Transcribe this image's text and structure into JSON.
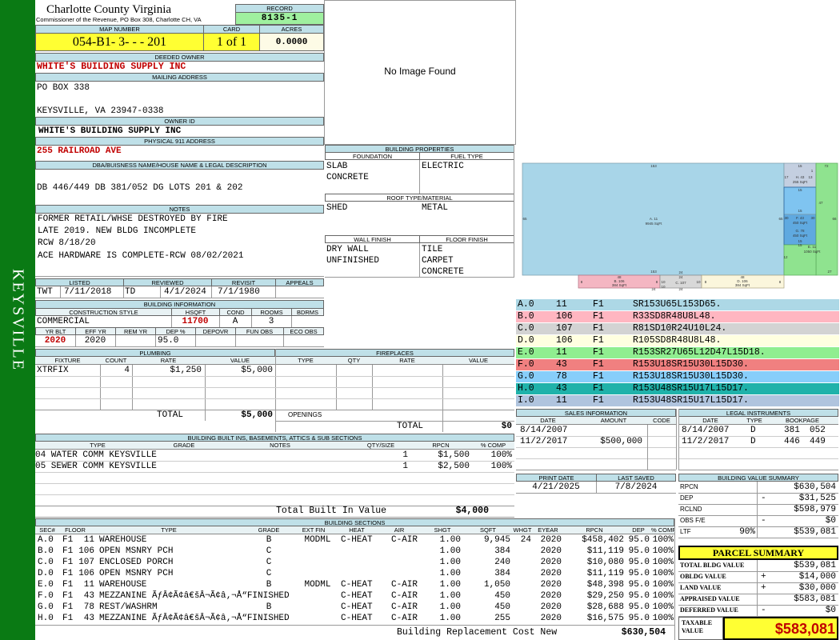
{
  "header": {
    "county": "Charlotte County Virginia",
    "office": "Commissioner of the Revenue, PO Box 308, Charlotte CH, VA",
    "side_label": "KEYSVILLE"
  },
  "record": {
    "label": "RECORD",
    "value": "8135-1"
  },
  "map_number": {
    "label": "MAP NUMBER",
    "value": "054-B1- 3-   -   - 201"
  },
  "card": {
    "label": "CARD",
    "value": "1 of 1"
  },
  "acres": {
    "label": "ACRES",
    "value": "0.0000"
  },
  "deeded_owner": {
    "label": "DEEDED OWNER",
    "value": "WHITE'S BUILDING SUPPLY INC"
  },
  "mailing_address": {
    "label": "MAILING ADDRESS",
    "line1": "PO BOX 338",
    "line2": "KEYSVILLE, VA 23947-0338"
  },
  "owner_id": {
    "label": "OWNER ID",
    "value": "WHITE'S BUILDING SUPPLY INC"
  },
  "physical_address": {
    "label": "PHYSICAL 911 ADDRESS",
    "value": "255 RAILROAD AVE"
  },
  "legal": {
    "label": "DBA/BUISNESS NAME/HOUSE NAME & LEGAL DESCRIPTION",
    "value": "DB 446/449 DB 381/052 DG LOTS 201 & 202"
  },
  "notes": {
    "label": "NOTES",
    "lines": [
      "FORMER RETAIL/WHSE DESTROYED BY FIRE",
      "LATE 2019.  NEW BLDG INCOMPLETE",
      "RCW 8/18/20",
      "ACE HARDWARE IS COMPLETE-RCW 08/02/2021"
    ]
  },
  "photo": {
    "text": "No Image Found"
  },
  "listed": {
    "labels": [
      "LISTED",
      "REVIEWED",
      "REVISIT",
      "APPEALS"
    ],
    "listed_by": "TWT",
    "listed_date": "7/11/2018",
    "reviewed_by": "TD",
    "reviewed_date": "4/1/2024",
    "revisit": "7/1/1980",
    "appeals": ""
  },
  "building_info": {
    "label": "BUILDING INFORMATION",
    "labels": [
      "CONSTRUCTION STYLE",
      "HSQFT",
      "COND",
      "ROOMS",
      "BDRMS"
    ],
    "style": "COMMERCIAL",
    "hsqft": "11700",
    "cond": "A",
    "rooms": "3",
    "bdrms": "",
    "labels2": [
      "YR BLT",
      "EFF YR",
      "REM YR",
      "DEP %",
      "DEPOVR",
      "FUN OBS",
      "ECO OBS"
    ],
    "yr_blt": "2020",
    "eff_yr": "2020",
    "rem_yr": "",
    "dep": "95.0",
    "depovr": "",
    "fun_obs": "",
    "eco_obs": ""
  },
  "building_props": {
    "label": "BUILDING PROPERTIES",
    "foundation_label": "FOUNDATION",
    "fuel_label": "FUEL TYPE",
    "foundation": [
      "SLAB",
      "CONCRETE"
    ],
    "fuel": [
      "ELECTRIC"
    ],
    "roof_label": "ROOF TYPE/MATERIAL",
    "roof_type": "SHED",
    "roof_material": "METAL",
    "wall_label": "WALL FINISH",
    "floor_label": "FLOOR FINISH",
    "wall": [
      "DRY WALL",
      "UNFINISHED"
    ],
    "floor": [
      "TILE",
      "CARPET",
      "CONCRETE"
    ]
  },
  "sketch": {
    "rects": [
      {
        "tag": "A. 11",
        "area": "9945 SqFt",
        "color": "#a8d5e8",
        "top": "153",
        "left": "65",
        "right": "65"
      },
      {
        "tag": "B. 106",
        "area": "384 SqFt",
        "color": "#f4b6c2",
        "top": "48",
        "left": "8",
        "right": "8"
      },
      {
        "tag": "C. 107",
        "area": "240",
        "color": "#d8d8d8",
        "top": "24",
        "left": "10",
        "right": "10"
      },
      {
        "tag": "D. 106",
        "area": "384 SqFt",
        "color": "#fbf6dc",
        "top": "48",
        "left": "8",
        "right": "8"
      },
      {
        "tag": "E. 11",
        "area": "1050 SqFt",
        "color": "#8fe38f",
        "top": "15",
        "left": "",
        "right": "47"
      },
      {
        "tag": "F. 43",
        "area": "450 SqFt",
        "color": "#5fa9e0",
        "top": "15",
        "left": "30",
        "right": "30"
      },
      {
        "tag": "G. 78",
        "area": "450 SqFt",
        "color": "#7fc4f0",
        "top": "",
        "left": "",
        "right": ""
      },
      {
        "tag": "H. 43",
        "area": "255 SqFt",
        "color": "#c4cfe0",
        "top": "15",
        "left": "17",
        "right": "17"
      },
      {
        "tag": "I. 11",
        "area": "",
        "color": "#b8c8dc",
        "top": "72",
        "left": "",
        "right": "66"
      }
    ],
    "extra_labels": [
      "1",
      "13",
      "24",
      "12",
      "24",
      "10",
      "27",
      "24",
      "15",
      "15"
    ]
  },
  "sketch_legend": [
    {
      "sec": "A.0",
      "code": "11",
      "floor": "F1",
      "vectors": "SR153U65L153D65.",
      "color": "#add8e6"
    },
    {
      "sec": "B.0",
      "code": "106",
      "floor": "F1",
      "vectors": "R33SD8R48U8L48.",
      "color": "#ffb6c1"
    },
    {
      "sec": "C.0",
      "code": "107",
      "floor": "F1",
      "vectors": "R81SD10R24U10L24.",
      "color": "#d3d3d3"
    },
    {
      "sec": "D.0",
      "code": "106",
      "floor": "F1",
      "vectors": "R105SD8R48U8L48.",
      "color": "#ffffe0"
    },
    {
      "sec": "E.0",
      "code": "11",
      "floor": "F1",
      "vectors": "R153SR27U65L12D47L15D18.",
      "color": "#90ee90"
    },
    {
      "sec": "F.0",
      "code": "43",
      "floor": "F1",
      "vectors": "R153U18SR15U30L15D30.",
      "color": "#f08080"
    },
    {
      "sec": "G.0",
      "code": "78",
      "floor": "F1",
      "vectors": "R153U18SR15U30L15D30.",
      "color": "#87cefa"
    },
    {
      "sec": "H.0",
      "code": "43",
      "floor": "F1",
      "vectors": "R153U48SR15U17L15D17.",
      "color": "#20b2aa"
    },
    {
      "sec": "I.0",
      "code": "11",
      "floor": "F1",
      "vectors": "R153U48SR15U17L15D17.",
      "color": "#b0c4de"
    }
  ],
  "plumbing": {
    "label": "PLUMBING",
    "cols": [
      "FIXTURE",
      "COUNT",
      "RATE",
      "VALUE"
    ],
    "rows": [
      {
        "fixture": "XTRFIX",
        "count": "4",
        "rate": "$1,250",
        "value": "$5,000"
      }
    ],
    "total_label": "TOTAL",
    "total": "$5,000"
  },
  "fireplaces": {
    "label": "FIREPLACES",
    "cols": [
      "TYPE",
      "QTY",
      "RATE",
      "VALUE"
    ],
    "openings_label": "OPENINGS",
    "total_label": "TOTAL",
    "total": "$0"
  },
  "sales": {
    "label": "SALES INFORMATION",
    "cols": [
      "DATE",
      "AMOUNT",
      "CODE"
    ],
    "rows": [
      {
        "date": "8/14/2007",
        "amount": "",
        "code": ""
      },
      {
        "date": "11/2/2017",
        "amount": "$500,000",
        "code": ""
      }
    ]
  },
  "legal_instruments": {
    "label": "LEGAL INSTRUMENTS",
    "cols": [
      "DATE",
      "TYPE",
      "BOOKPAGE"
    ],
    "rows": [
      {
        "date": "8/14/2007",
        "type": "D",
        "book": "381",
        "page": "052"
      },
      {
        "date": "11/2/2017",
        "type": "D",
        "book": "446",
        "page": "449"
      }
    ]
  },
  "built_ins": {
    "label": "BUILDING BUILT INS, BASEMENTS, ATTICS & SUB SECTIONS",
    "cols": [
      "TYPE",
      "GRADE",
      "NOTES",
      "QTY/SIZE",
      "RPCN",
      "% COMP"
    ],
    "rows": [
      {
        "type": "04 WATER COMM KEYSVILLE",
        "grade": "",
        "notes": "",
        "qty": "1",
        "rpcn": "$1,500",
        "comp": "100%"
      },
      {
        "type": "05 SEWER COMM KEYSVILLE",
        "grade": "",
        "notes": "",
        "qty": "1",
        "rpcn": "$2,500",
        "comp": "100%"
      }
    ],
    "total_label": "Total Built In Value",
    "total": "$4,000"
  },
  "print_info": {
    "print_label": "PRINT DATE",
    "print_date": "4/21/2025",
    "saved_label": "LAST SAVED",
    "saved_date": "7/8/2024"
  },
  "value_summary": {
    "label": "BUILDING VALUE SUMMARY",
    "rows": [
      {
        "label": "RPCN",
        "sign": "",
        "pct": "",
        "value": "$630,504"
      },
      {
        "label": "DEP",
        "sign": "-",
        "pct": "",
        "value": "$31,525"
      },
      {
        "label": "RCLND",
        "sign": "",
        "pct": "",
        "value": "$598,979"
      },
      {
        "label": "OBS F/E",
        "sign": "-",
        "pct": "",
        "value": "$0"
      },
      {
        "label": "LTF",
        "sign": "",
        "pct": "90%",
        "value": "$539,081"
      }
    ]
  },
  "parcel_summary": {
    "label": "PARCEL SUMMARY",
    "rows": [
      {
        "label": "TOTAL BLDG VALUE",
        "sign": "",
        "value": "$539,081"
      },
      {
        "label": "OBLDG VALUE",
        "sign": "+",
        "value": "$14,000"
      },
      {
        "label": "LAND VALUE",
        "sign": "+",
        "value": "$30,000"
      },
      {
        "label": "APPRAISED VALUE",
        "sign": "",
        "value": "$583,081"
      },
      {
        "label": "DEFERRED VALUE",
        "sign": "-",
        "value": "$0"
      }
    ],
    "taxable_label": "TAXABLE VALUE",
    "taxable": "$583,081"
  },
  "sections": {
    "label": "BUILDING SECTIONS",
    "cols": [
      "SEC#",
      "FLOOR",
      "TYPE",
      "GRADE",
      "EXT FIN",
      "HEAT",
      "AIR",
      "SHGT",
      "SQFT",
      "WHGT",
      "EYEAR",
      "RPCN",
      "DEP",
      "% COMP"
    ],
    "rows": [
      {
        "sec": "A.0",
        "floor": "F1",
        "code": "11",
        "type": "WAREHOUSE",
        "grade": "B",
        "ext": "MODML",
        "heat": "C-HEAT",
        "air": "C-AIR",
        "shgt": "1.00",
        "sqft": "9,945",
        "whgt": "24",
        "eyear": "2020",
        "rpcn": "$458,402",
        "dep": "95.0",
        "comp": "100%"
      },
      {
        "sec": "B.0",
        "floor": "F1",
        "code": "106",
        "type": "OPEN MSNRY PCH",
        "grade": "C",
        "ext": "",
        "heat": "",
        "air": "",
        "shgt": "1.00",
        "sqft": "384",
        "whgt": "",
        "eyear": "2020",
        "rpcn": "$11,119",
        "dep": "95.0",
        "comp": "100%"
      },
      {
        "sec": "C.0",
        "floor": "F1",
        "code": "107",
        "type": "ENCLOSED PORCH",
        "grade": "C",
        "ext": "",
        "heat": "",
        "air": "",
        "shgt": "1.00",
        "sqft": "240",
        "whgt": "",
        "eyear": "2020",
        "rpcn": "$10,080",
        "dep": "95.0",
        "comp": "100%"
      },
      {
        "sec": "D.0",
        "floor": "F1",
        "code": "106",
        "type": "OPEN MSNRY PCH",
        "grade": "C",
        "ext": "",
        "heat": "",
        "air": "",
        "shgt": "1.00",
        "sqft": "384",
        "whgt": "",
        "eyear": "2020",
        "rpcn": "$11,119",
        "dep": "95.0",
        "comp": "100%"
      },
      {
        "sec": "E.0",
        "floor": "F1",
        "code": "11",
        "type": "WAREHOUSE",
        "grade": "B",
        "ext": "MODML",
        "heat": "C-HEAT",
        "air": "C-AIR",
        "shgt": "1.00",
        "sqft": "1,050",
        "whgt": "",
        "eyear": "2020",
        "rpcn": "$48,398",
        "dep": "95.0",
        "comp": "100%"
      },
      {
        "sec": "F.0",
        "floor": "F1",
        "code": "43",
        "type": "MEZZANINE ÃƒÂ¢Ã¢â€šÂ¬Ã¢â‚¬Å“FINISHED",
        "grade": "",
        "ext": "",
        "heat": "C-HEAT",
        "air": "C-AIR",
        "shgt": "1.00",
        "sqft": "450",
        "whgt": "",
        "eyear": "2020",
        "rpcn": "$29,250",
        "dep": "95.0",
        "comp": "100%"
      },
      {
        "sec": "G.0",
        "floor": "F1",
        "code": "78",
        "type": "REST/WASHRM",
        "grade": "B",
        "ext": "",
        "heat": "C-HEAT",
        "air": "C-AIR",
        "shgt": "1.00",
        "sqft": "450",
        "whgt": "",
        "eyear": "2020",
        "rpcn": "$28,688",
        "dep": "95.0",
        "comp": "100%"
      },
      {
        "sec": "H.0",
        "floor": "F1",
        "code": "43",
        "type": "MEZZANINE ÃƒÂ¢Ã¢â€šÂ¬Ã¢â‚¬Å“FINISHED",
        "grade": "",
        "ext": "",
        "heat": "C-HEAT",
        "air": "C-AIR",
        "shgt": "1.00",
        "sqft": "255",
        "whgt": "",
        "eyear": "2020",
        "rpcn": "$16,575",
        "dep": "95.0",
        "comp": "100%"
      }
    ],
    "total_label": "Building Replacement Cost New",
    "total": "$630,504"
  }
}
